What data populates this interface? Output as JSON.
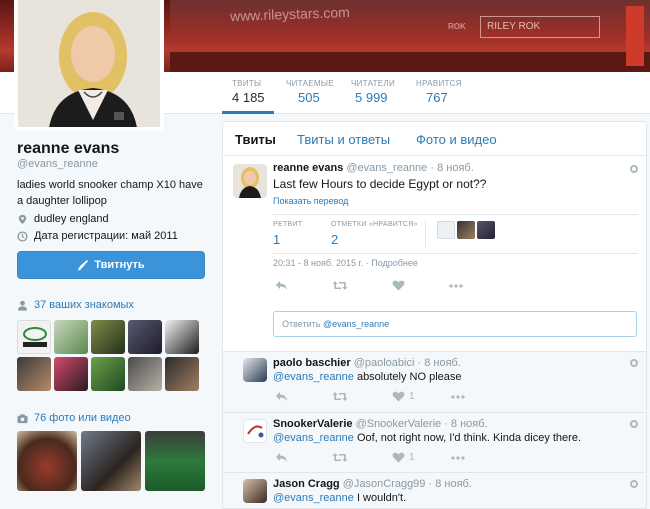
{
  "banner": {
    "url_text": "www.rileystars.com",
    "sign_text": "RILEY ROK",
    "brand_text": "ROK"
  },
  "nav": {
    "stats": [
      {
        "label": "ТВИТЫ",
        "value": "4 185"
      },
      {
        "label": "ЧИТАЕМЫЕ",
        "value": "505"
      },
      {
        "label": "ЧИТАТЕЛИ",
        "value": "5 999"
      },
      {
        "label": "НРАВИТСЯ",
        "value": "767"
      }
    ]
  },
  "profile": {
    "name": "reanne evans",
    "handle": "@evans_reanne",
    "bio": "ladies world snooker champ X10 have a daughter lollipop",
    "location": "dudley england",
    "joined": "Дата регистрации: май 2011",
    "tweet_button": "Твитнуть",
    "followers_you_know": "37 ваших знакомых",
    "photos_videos": "76 фото или видео"
  },
  "timeline": {
    "tabs": [
      "Твиты",
      "Твиты и ответы",
      "Фото и видео"
    ],
    "main_tweet": {
      "name": "reanne evans",
      "handle": "@evans_reanne",
      "time": "8 нояб.",
      "text": "Last few Hours to decide Egypt or not??",
      "translate": "Показать перевод",
      "retweets_label": "РЕТВИТ",
      "retweets": "1",
      "likes_label": "ОТМЕТКИ «НРАВИТСЯ»",
      "likes": "2",
      "date": "20:31 - 8 нояб. 2015 г. · Подробнее",
      "reply_placeholder": "Ответить ",
      "reply_mention": "@evans_reanne"
    },
    "replies": [
      {
        "name": "paolo baschier",
        "handle": "@paoloabici",
        "time": "8 нояб.",
        "mention": "@evans_reanne",
        "text": " absolutely NO please",
        "likes": "1"
      },
      {
        "name": "SnookerValerie",
        "handle": "@SnookerValerie",
        "time": "8 нояб.",
        "mention": "@evans_reanne",
        "text": " Oof, not right now, I'd think. Kinda dicey there.",
        "likes": "1"
      },
      {
        "name": "Jason Cragg",
        "handle": "@JasonCragg99",
        "time": "8 нояб.",
        "mention": "@evans_reanne",
        "text": " I wouldn't.",
        "likes": ""
      }
    ]
  },
  "colors": {
    "accent": "#2b7bb9",
    "button": "#3b94d9",
    "background": "#f5f8fa",
    "muted": "#8899a6"
  }
}
